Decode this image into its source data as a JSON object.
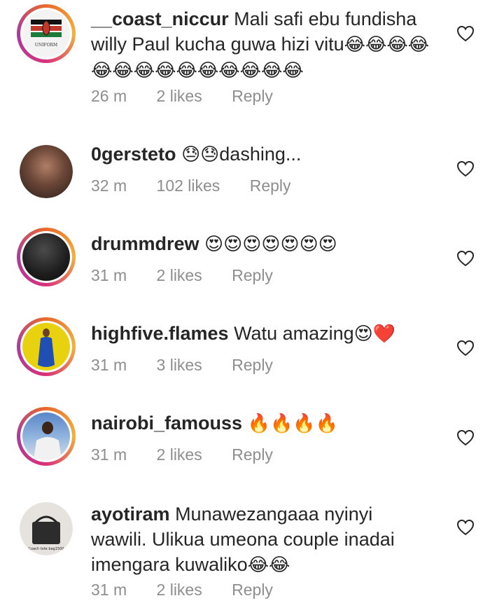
{
  "comments": [
    {
      "username": "__coast_niccur",
      "text": " Mali safi ebu fundisha willy Paul kucha guwa hizi vitu",
      "emojis": "😂😂😂😂😂😂😂😂😂😂😂😂😂😂",
      "time": "26 m",
      "likes": "2 likes",
      "reply": "Reply",
      "avatar_text": "UNIFORM"
    },
    {
      "username": "0gersteto",
      "text": "",
      "emojis": "😓😓",
      "text_after": "dashing...",
      "time": "32 m",
      "likes": "102 likes",
      "reply": "Reply"
    },
    {
      "username": "drummdrew",
      "text": " ",
      "emojis": "😍😍😍😍😍😍😍",
      "time": "31 m",
      "likes": "2 likes",
      "reply": "Reply"
    },
    {
      "username": "highfive.flames",
      "text": " Watu amazing",
      "emojis": "😍❤️",
      "time": "31 m",
      "likes": "3 likes",
      "reply": "Reply"
    },
    {
      "username": "nairobi_famouss",
      "text": " ",
      "emojis": "🔥🔥🔥🔥",
      "time": "31 m",
      "likes": "2 likes",
      "reply": "Reply"
    },
    {
      "username": "ayotiram",
      "text": " Munawezangaaa nyinyi wawili. Ulikua umeona couple inadai imengara kuwaliko",
      "emojis": "😂😂",
      "time": "31 m",
      "likes": "2 likes",
      "reply": "Reply",
      "avatar_text": "Coach tote bag1500"
    }
  ],
  "icons": {
    "like": "heart-outline-icon"
  },
  "colors": {
    "text": "#262626",
    "meta": "#8e8e8e",
    "ring_start": "#e96a2c",
    "ring_end": "#a83b9d"
  }
}
